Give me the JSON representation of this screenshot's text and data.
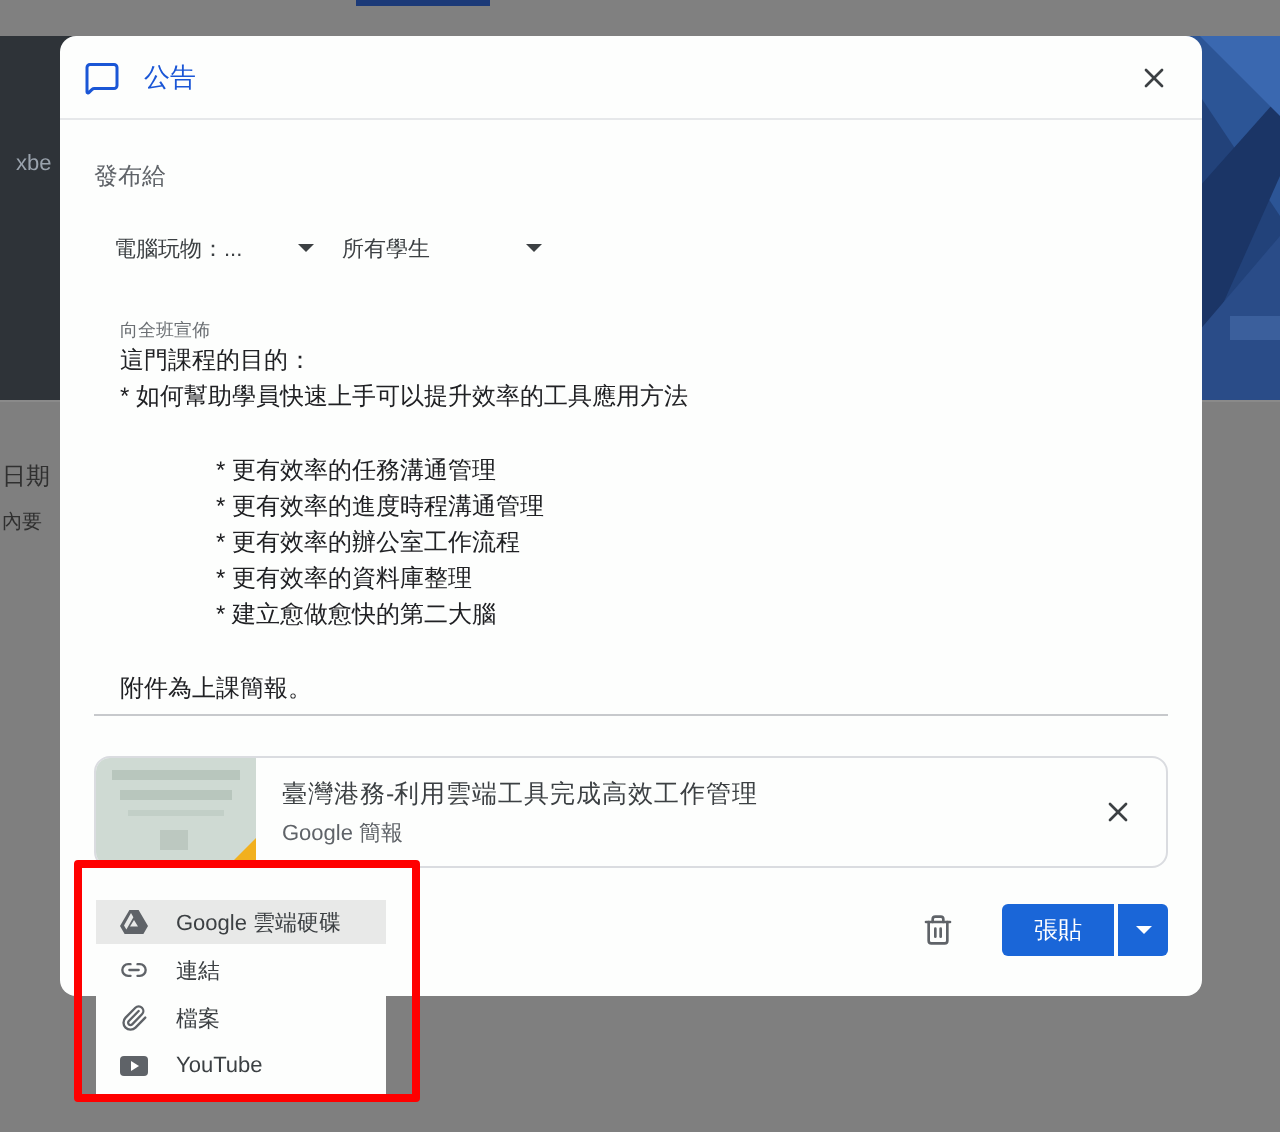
{
  "background": {
    "banner_subtitle": "xbe",
    "list_texts": [
      "日期",
      "內要"
    ]
  },
  "dialog": {
    "title": "公告",
    "audience_label": "發布給",
    "dropdowns": [
      {
        "value": "電腦玩物：..."
      },
      {
        "value": "所有學生"
      }
    ],
    "field_label": "向全班宣佈",
    "body": [
      {
        "kind": "plain",
        "lines": [
          "這門課程的目的：",
          "* 如何幫助學員快速上手可以提升效率的工具應用方法"
        ]
      },
      {
        "kind": "indented",
        "lines": [
          "* 更有效率的任務溝通管理",
          "* 更有效率的進度時程溝通管理",
          "* 更有效率的辦公室工作流程",
          "* 更有效率的資料庫整理",
          "* 建立愈做愈快的第二大腦"
        ]
      },
      {
        "kind": "plain",
        "lines": [
          "附件為上課簡報。"
        ]
      }
    ],
    "attachment": {
      "title": "臺灣港務-利用雲端工具完成高效工作管理",
      "type": "Google 簡報"
    },
    "post_button": "張貼"
  },
  "add_menu": {
    "items": [
      {
        "label": "Google 雲端硬碟",
        "kind": "drive",
        "selected": true
      },
      {
        "label": "連結",
        "kind": "link",
        "selected": false
      },
      {
        "label": "檔案",
        "kind": "file",
        "selected": false
      },
      {
        "label": "YouTube",
        "kind": "youtube",
        "selected": false
      }
    ]
  }
}
